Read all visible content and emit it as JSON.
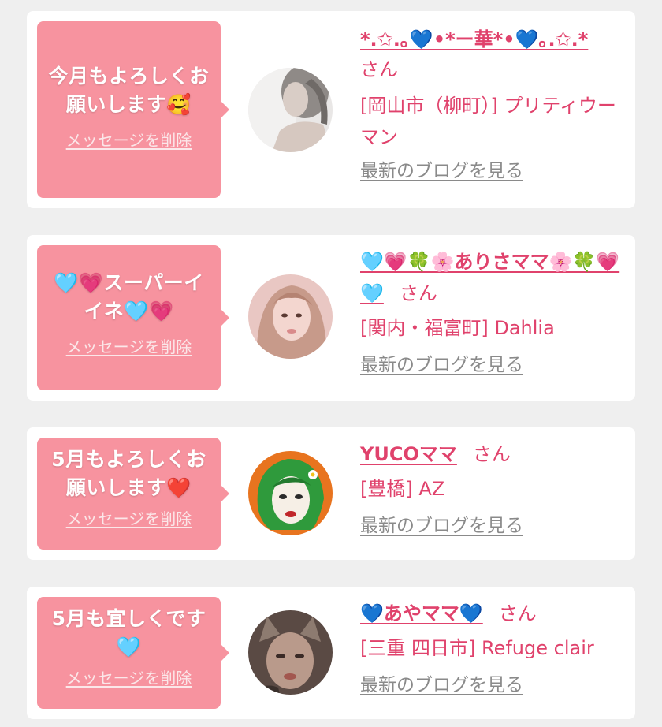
{
  "colors": {
    "background": "#efefef",
    "card": "#ffffff",
    "bubble": "#f7939f",
    "accent": "#e0426c",
    "link_gray": "#8a8a8a"
  },
  "cards": [
    {
      "message": "今月もよろしくお\n願いします🥰",
      "delete_label": "メッセージを削除",
      "avatar_icon": "portrait-photo-woman-gray",
      "name": "*.✩.｡💙•*ー華*•💙｡.✩.*",
      "honorific": "さん",
      "shop": "[岡山市（柳町）] プリティウーマン",
      "blog_label": "最新のブログを見る"
    },
    {
      "message": "🩵💗スーパーイ\nイネ🩵💗",
      "delete_label": "メッセージを削除",
      "avatar_icon": "portrait-photo-woman-pink",
      "name": "🩵💗🍀🌸ありさママ🌸🍀💗🩵",
      "honorific": "さん",
      "shop": "[関内・福富町] Dahlia",
      "blog_label": "最新のブログを見る"
    },
    {
      "message": "5月もよろしくお\n願いします❤️",
      "delete_label": "メッセージを削除",
      "avatar_icon": "illustration-green-hair-woman",
      "name": "YUCOママ",
      "honorific": "さん",
      "shop": "[豊橋] AZ",
      "blog_label": "最新のブログを見る"
    },
    {
      "message": "5月も宜しくです\n🩵",
      "delete_label": "メッセージを削除",
      "avatar_icon": "portrait-photo-cat-filter",
      "name": "💙あやママ💙",
      "honorific": "さん",
      "shop": "[三重 四日市] Refuge clair",
      "blog_label": "最新のブログを見る"
    }
  ]
}
